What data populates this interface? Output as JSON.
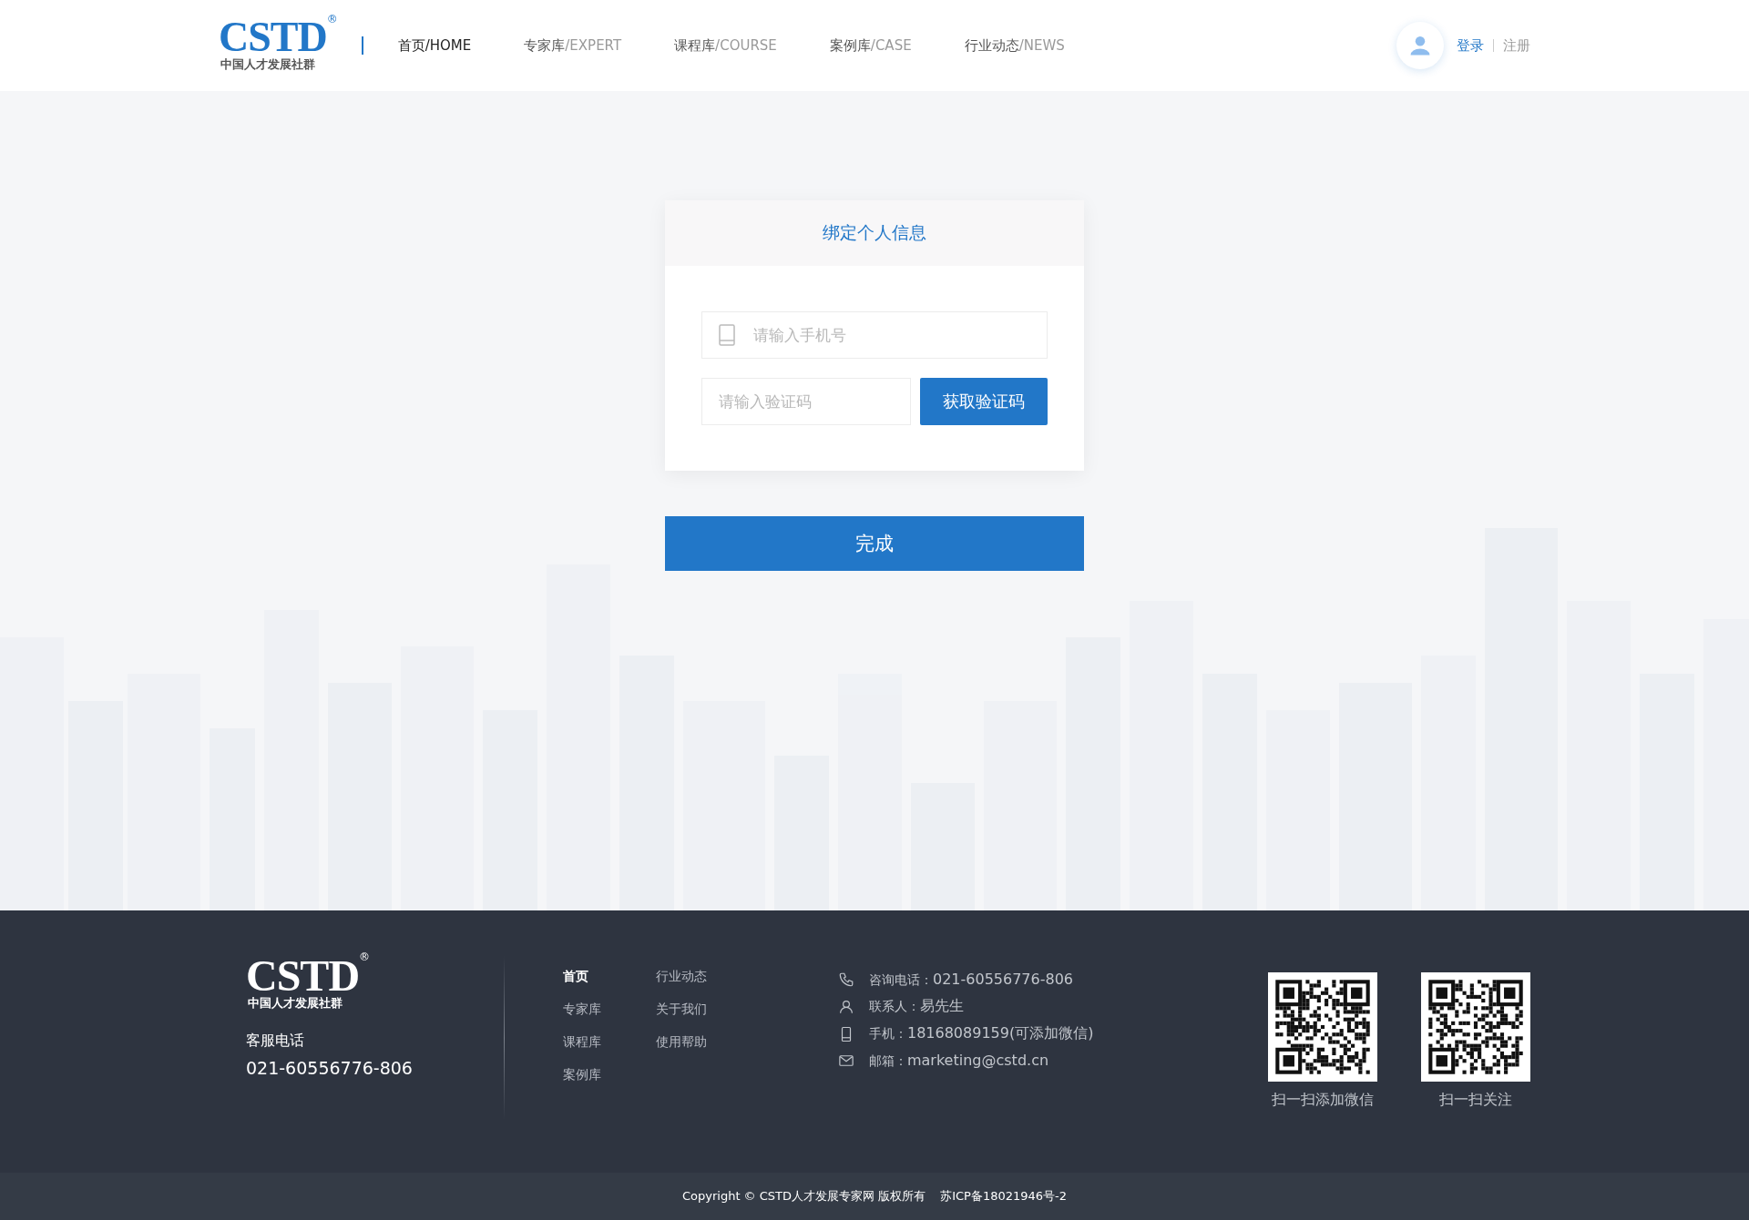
{
  "header": {
    "logo": {
      "mark": "CSTD",
      "reg": "®",
      "tagline": "中国人才发展社群"
    },
    "nav": [
      {
        "name": "首页",
        "suffix": "/HOME",
        "selected": true
      },
      {
        "name": "专家库",
        "suffix": "/EXPERT",
        "selected": false
      },
      {
        "name": "课程库",
        "suffix": "/COURSE",
        "selected": false
      },
      {
        "name": "案例库",
        "suffix": "/CASE",
        "selected": false
      },
      {
        "name": "行业动态",
        "suffix": "/NEWS",
        "selected": false
      }
    ],
    "login": "登录",
    "register": "注册"
  },
  "form": {
    "title": "绑定个人信息",
    "phone": {
      "placeholder": "请输入手机号"
    },
    "code": {
      "placeholder": "请输入验证码"
    },
    "get_code": "获取验证码",
    "submit": "完成"
  },
  "footer": {
    "logo": {
      "mark": "CSTD",
      "reg": "®",
      "tagline": "中国人才发展社群"
    },
    "service_label": "客服电话",
    "service_phone": "021-60556776-806",
    "links": [
      {
        "label": "首页",
        "selected": true
      },
      {
        "label": "专家库",
        "selected": false
      },
      {
        "label": "课程库",
        "selected": false
      },
      {
        "label": "案例库",
        "selected": false
      },
      {
        "label": "行业动态",
        "selected": false
      },
      {
        "label": "关于我们",
        "selected": false
      },
      {
        "label": "使用帮助",
        "selected": false
      }
    ],
    "contacts": [
      {
        "kind": "phone",
        "label": "咨询电话：",
        "value": "021-60556776-806"
      },
      {
        "kind": "person",
        "label": "联系人：",
        "value": "易先生"
      },
      {
        "kind": "mobile",
        "label": "手机：",
        "value": "18168089159(可添加微信)"
      },
      {
        "kind": "mail",
        "label": "邮箱：",
        "value": "marketing@cstd.cn"
      }
    ],
    "qrcodes": [
      {
        "caption": "扫一扫添加微信"
      },
      {
        "caption": "扫一扫关注"
      }
    ],
    "copyright": "Copyright © CSTD人才发展专家网 版权所有",
    "icp": "苏ICP备18021946号-2"
  }
}
